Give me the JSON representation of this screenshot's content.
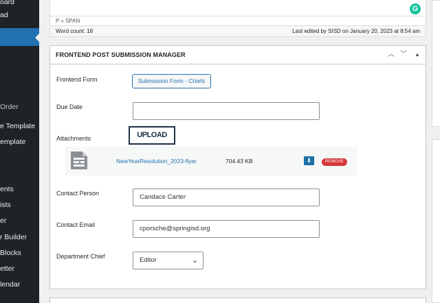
{
  "sidebar": {
    "items": [
      {
        "label": "oard"
      },
      {
        "label": "ad"
      },
      {
        "label": ""
      },
      {
        "label": "Order"
      },
      {
        "label": "e Template"
      },
      {
        "label": "emplate"
      },
      {
        "label": "ents"
      },
      {
        "label": "ists"
      },
      {
        "label": "er"
      },
      {
        "label": "r Builder"
      },
      {
        "label": "Blocks"
      },
      {
        "label": "etter"
      },
      {
        "label": "lendar"
      }
    ]
  },
  "editor": {
    "grammarly_icon": "G",
    "path": "P » SPAN",
    "word_count": "Word count: 18",
    "last_edited": "Last edited by SISD on January 20, 2023 at 8:54 am"
  },
  "metabox": {
    "title": "FRONTEND POST SUBMISSION MANAGER",
    "controls": {
      "up": "︿",
      "down": "﹀",
      "toggle": "▲"
    },
    "frontend_form": {
      "label": "Frontend Form",
      "button": "Submission Form - Chiefs"
    },
    "due_date": {
      "label": "Due Date",
      "value": ""
    },
    "attachments": {
      "label": "Attachments",
      "upload_button": "UPLOAD",
      "file": {
        "name": "NewYearResolution_2023-flyer",
        "size": "704.43 KB",
        "remove": "REMOVE"
      }
    },
    "contact_person": {
      "label": "Contact Person",
      "value": "Candace Carter"
    },
    "contact_email": {
      "label": "Contact Email",
      "value": "cporsche@springisd.org"
    },
    "department_chief": {
      "label": "Department Chief",
      "value": "Editor",
      "chevron": "⌄"
    }
  },
  "colors": {
    "accent": "#2271b1",
    "sidebar": "#1d2327",
    "remove": "#d63638",
    "grammarly": "#15c39a"
  },
  "icons": {
    "file": "document-icon",
    "download": "download-icon",
    "grammarly": "grammarly-icon"
  }
}
